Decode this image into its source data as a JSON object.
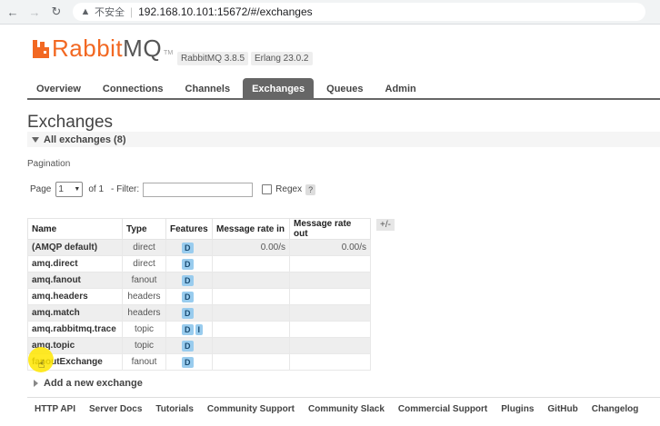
{
  "browser": {
    "back_icon": "arrow-left-icon",
    "forward_icon": "arrow-right-icon",
    "reload_icon": "reload-icon",
    "security_label": "不安全",
    "url": "192.168.10.101:15672/#/exchanges"
  },
  "header": {
    "logo_rabbit": "Rabbit",
    "logo_mq": "MQ",
    "logo_tm": "TM",
    "version": "RabbitMQ 3.8.5",
    "erlang": "Erlang 23.0.2"
  },
  "tabs": [
    {
      "label": "Overview"
    },
    {
      "label": "Connections"
    },
    {
      "label": "Channels"
    },
    {
      "label": "Exchanges",
      "active": true
    },
    {
      "label": "Queues"
    },
    {
      "label": "Admin"
    }
  ],
  "page": {
    "title": "Exchanges",
    "section_title": "All exchanges (8)",
    "pagination_label": "Pagination",
    "page_label": "Page",
    "page_value": "1",
    "of_label": "of 1",
    "filter_label": "- Filter:",
    "filter_value": "",
    "regex_label": "Regex",
    "help_label": "?"
  },
  "table": {
    "columns": [
      "Name",
      "Type",
      "Features",
      "Message rate in",
      "Message rate out"
    ],
    "column_toggle": "+/-",
    "rows": [
      {
        "name": "(AMQP default)",
        "type": "direct",
        "features": [
          "D"
        ],
        "rate_in": "0.00/s",
        "rate_out": "0.00/s"
      },
      {
        "name": "amq.direct",
        "type": "direct",
        "features": [
          "D"
        ],
        "rate_in": "",
        "rate_out": ""
      },
      {
        "name": "amq.fanout",
        "type": "fanout",
        "features": [
          "D"
        ],
        "rate_in": "",
        "rate_out": ""
      },
      {
        "name": "amq.headers",
        "type": "headers",
        "features": [
          "D"
        ],
        "rate_in": "",
        "rate_out": ""
      },
      {
        "name": "amq.match",
        "type": "headers",
        "features": [
          "D"
        ],
        "rate_in": "",
        "rate_out": ""
      },
      {
        "name": "amq.rabbitmq.trace",
        "type": "topic",
        "features": [
          "D",
          "I"
        ],
        "rate_in": "",
        "rate_out": ""
      },
      {
        "name": "amq.topic",
        "type": "topic",
        "features": [
          "D"
        ],
        "rate_in": "",
        "rate_out": ""
      },
      {
        "name": "fanoutExchange",
        "type": "fanout",
        "features": [
          "D"
        ],
        "rate_in": "",
        "rate_out": ""
      }
    ]
  },
  "add_new_label": "Add a new exchange",
  "footer": [
    "HTTP API",
    "Server Docs",
    "Tutorials",
    "Community Support",
    "Community Slack",
    "Commercial Support",
    "Plugins",
    "GitHub",
    "Changelog"
  ],
  "colors": {
    "brand": "#f26822",
    "tab_active": "#666666",
    "badge": "#99ccee"
  }
}
